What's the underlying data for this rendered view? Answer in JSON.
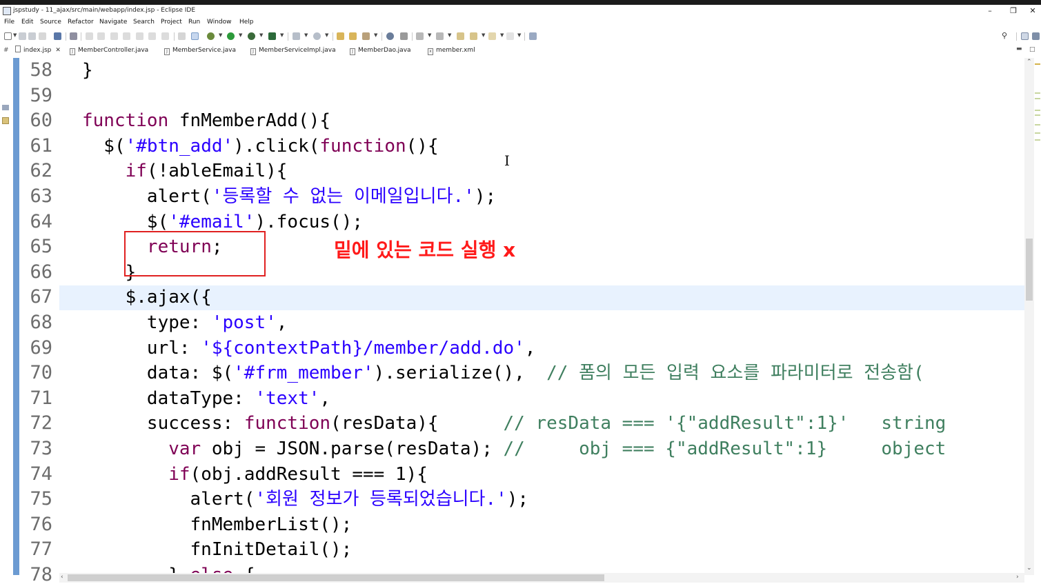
{
  "window": {
    "title": "jspstudy - 11_ajax/src/main/webapp/index.jsp - Eclipse IDE",
    "minimize": "–",
    "maximize": "❐",
    "close": "✕"
  },
  "menu": [
    "File",
    "Edit",
    "Source",
    "Refactor",
    "Navigate",
    "Search",
    "Project",
    "Run",
    "Window",
    "Help"
  ],
  "tabs": [
    {
      "label": "index.jsp",
      "active": true,
      "close": "✕"
    },
    {
      "label": "MemberController.java"
    },
    {
      "label": "MemberService.java"
    },
    {
      "label": "MemberServiceImpl.java"
    },
    {
      "label": "MemberDao.java"
    },
    {
      "label": "member.xml"
    }
  ],
  "editor": {
    "current_line": "67",
    "lines": [
      {
        "n": "58",
        "segs": [
          {
            "t": "}",
            "c": "pl"
          }
        ]
      },
      {
        "n": "59",
        "segs": []
      },
      {
        "n": "60",
        "segs": [
          {
            "t": "function",
            "c": "kw"
          },
          {
            "t": " fnMemberAdd(){",
            "c": "pl"
          }
        ]
      },
      {
        "n": "61",
        "segs": [
          {
            "t": "  $(",
            "c": "pl"
          },
          {
            "t": "'#btn_add'",
            "c": "str"
          },
          {
            "t": ").click(",
            "c": "pl"
          },
          {
            "t": "function",
            "c": "kw"
          },
          {
            "t": "(){",
            "c": "pl"
          }
        ]
      },
      {
        "n": "62",
        "segs": [
          {
            "t": "    ",
            "c": "pl"
          },
          {
            "t": "if",
            "c": "kw"
          },
          {
            "t": "(!ableEmail){",
            "c": "pl"
          }
        ]
      },
      {
        "n": "63",
        "segs": [
          {
            "t": "      alert(",
            "c": "pl"
          },
          {
            "t": "'등록할 수 없는 이메일입니다.'",
            "c": "str"
          },
          {
            "t": ");",
            "c": "pl"
          }
        ]
      },
      {
        "n": "64",
        "segs": [
          {
            "t": "      $(",
            "c": "pl"
          },
          {
            "t": "'#email'",
            "c": "str"
          },
          {
            "t": ").focus();",
            "c": "pl"
          }
        ]
      },
      {
        "n": "65",
        "segs": [
          {
            "t": "      ",
            "c": "pl"
          },
          {
            "t": "return",
            "c": "kw"
          },
          {
            "t": ";",
            "c": "pl"
          }
        ]
      },
      {
        "n": "66",
        "segs": [
          {
            "t": "    }",
            "c": "pl"
          }
        ]
      },
      {
        "n": "67",
        "segs": [
          {
            "t": "    $.ajax({",
            "c": "pl"
          }
        ]
      },
      {
        "n": "68",
        "segs": [
          {
            "t": "      type: ",
            "c": "pl"
          },
          {
            "t": "'post'",
            "c": "str"
          },
          {
            "t": ",",
            "c": "pl"
          }
        ]
      },
      {
        "n": "69",
        "segs": [
          {
            "t": "      url: ",
            "c": "pl"
          },
          {
            "t": "'${contextPath}/member/add.do'",
            "c": "str"
          },
          {
            "t": ",",
            "c": "pl"
          }
        ]
      },
      {
        "n": "70",
        "segs": [
          {
            "t": "      data: $(",
            "c": "pl"
          },
          {
            "t": "'#frm_member'",
            "c": "str"
          },
          {
            "t": ").serialize(),  ",
            "c": "pl"
          },
          {
            "t": "// 폼의 모든 입력 요소를 파라미터로 전송함(",
            "c": "cm"
          }
        ]
      },
      {
        "n": "71",
        "segs": [
          {
            "t": "      dataType: ",
            "c": "pl"
          },
          {
            "t": "'text'",
            "c": "str"
          },
          {
            "t": ",",
            "c": "pl"
          }
        ]
      },
      {
        "n": "72",
        "segs": [
          {
            "t": "      success: ",
            "c": "pl"
          },
          {
            "t": "function",
            "c": "kw"
          },
          {
            "t": "(resData){      ",
            "c": "pl"
          },
          {
            "t": "// resData === '{\"addResult\":1}'   string",
            "c": "cm"
          }
        ]
      },
      {
        "n": "73",
        "segs": [
          {
            "t": "        ",
            "c": "pl"
          },
          {
            "t": "var",
            "c": "kw"
          },
          {
            "t": " obj = JSON.parse(resData); ",
            "c": "pl"
          },
          {
            "t": "//     obj === {\"addResult\":1}     object",
            "c": "cm"
          }
        ]
      },
      {
        "n": "74",
        "segs": [
          {
            "t": "        ",
            "c": "pl"
          },
          {
            "t": "if",
            "c": "kw"
          },
          {
            "t": "(obj.addResult === 1){",
            "c": "pl"
          }
        ]
      },
      {
        "n": "75",
        "segs": [
          {
            "t": "          alert(",
            "c": "pl"
          },
          {
            "t": "'회원 정보가 등록되었습니다.'",
            "c": "str"
          },
          {
            "t": ");",
            "c": "pl"
          }
        ]
      },
      {
        "n": "76",
        "segs": [
          {
            "t": "          fnMemberList();",
            "c": "pl"
          }
        ]
      },
      {
        "n": "77",
        "segs": [
          {
            "t": "          fnInitDetail();",
            "c": "pl"
          }
        ]
      },
      {
        "n": "78",
        "segs": [
          {
            "t": "        } ",
            "c": "pl"
          },
          {
            "t": "else",
            "c": "kw"
          },
          {
            "t": " {",
            "c": "pl"
          }
        ]
      }
    ]
  },
  "annotation": {
    "text": "밑에 있는 코드 실행 x",
    "color": "#ff1a1a"
  },
  "icons": {
    "search": "search-icon",
    "perspective": "perspective-icon"
  },
  "colors": {
    "keyword": "#7f0055",
    "string": "#2a00ff",
    "comment": "#3f7f5f",
    "current_line": "#e8f2fe",
    "change_ruler": "#6c9bd2"
  }
}
